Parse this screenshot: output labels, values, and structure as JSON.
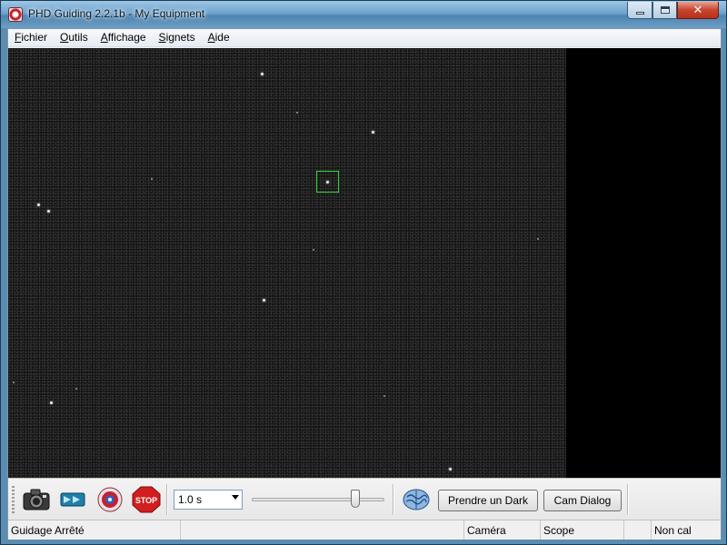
{
  "window": {
    "title": "PHD Guiding 2.2.1b - My Equipment",
    "close_glyph": "✕"
  },
  "menu": [
    {
      "accel": "F",
      "rest": "ichier"
    },
    {
      "accel": "O",
      "rest": "utils"
    },
    {
      "accel": "A",
      "rest": "ffichage"
    },
    {
      "accel": "S",
      "rest": "ignets"
    },
    {
      "accel": "A",
      "rest": "ide"
    }
  ],
  "toolbar": {
    "exposure_value": "1.0 s",
    "exposure_slider_fraction": 0.8,
    "dark_button_label": "Prendre un Dark",
    "cam_dialog_label": "Cam Dialog",
    "stop_label": "STOP",
    "icons": [
      "camera-icon",
      "loop-icon",
      "guide-target-icon",
      "stop-icon",
      "brain-icon"
    ]
  },
  "status": {
    "guiding": "Guidage Arrêté",
    "empty": "",
    "camera": "Caméra",
    "scope": "Scope",
    "empty2": "",
    "calibration": "Non cal"
  },
  "colors": {
    "guide_box": "#33d433",
    "stop_red": "#d21e1e",
    "background": "#000000"
  }
}
